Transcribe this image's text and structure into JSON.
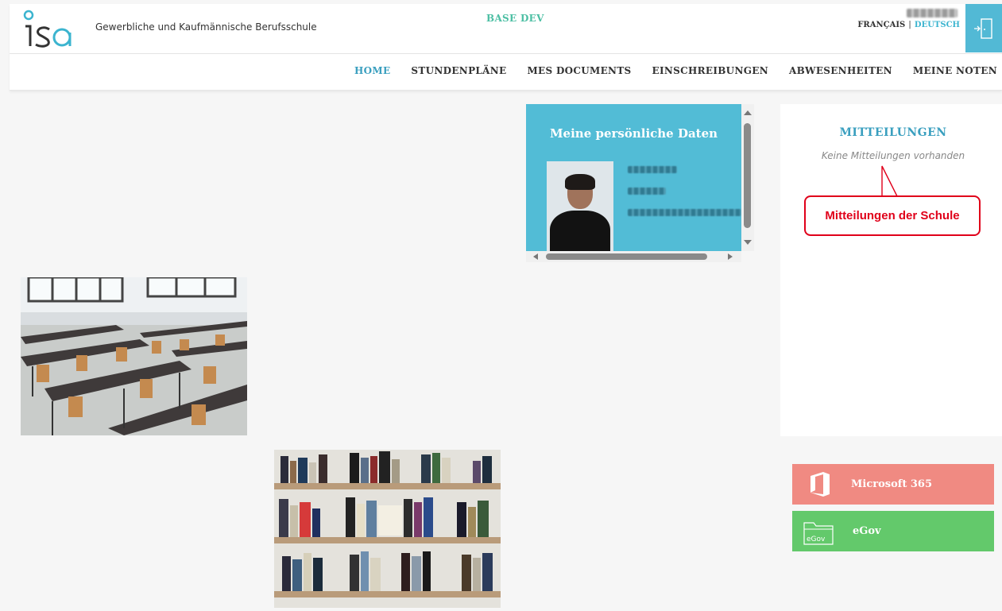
{
  "header": {
    "school_name": "Gewerbliche und Kaufmännische Berufsschule",
    "environment": "BASE DEV",
    "language_fr": "FRANÇAIS",
    "language_separator": "|",
    "language_de": "DEUTSCH"
  },
  "nav": {
    "items": [
      {
        "label": "HOME",
        "active": true
      },
      {
        "label": "STUNDENPLÄNE",
        "active": false
      },
      {
        "label": "MES DOCUMENTS",
        "active": false
      },
      {
        "label": "EINSCHREIBUNGEN",
        "active": false
      },
      {
        "label": "ABWESENHEITEN",
        "active": false
      },
      {
        "label": "MEINE NOTEN",
        "active": false
      }
    ]
  },
  "personal_data": {
    "title": "Meine persönliche Daten"
  },
  "notices": {
    "title": "MITTEILUNGEN",
    "empty_text": "Keine Mitteilungen vorhanden",
    "callout": "Mitteilungen der Schule"
  },
  "tiles": {
    "microsoft": {
      "label": "Microsoft 365",
      "icon": "office-icon",
      "color": "#f08a82"
    },
    "egov": {
      "label": "eGov",
      "icon": "egov-folder-icon",
      "icon_text": "eGov",
      "color": "#63c96b"
    }
  },
  "colors": {
    "accent": "#3a9fbf",
    "card": "#52bcd6",
    "env": "#4dbfa4",
    "callout": "#e0001a"
  }
}
